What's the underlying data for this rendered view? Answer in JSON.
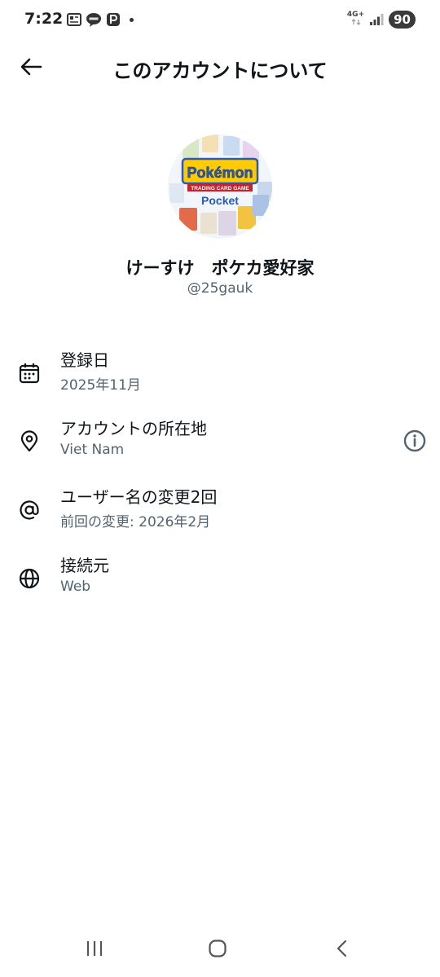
{
  "status_bar": {
    "time": "7:22",
    "network": "4G+",
    "battery": "90"
  },
  "header": {
    "title": "このアカウントについて"
  },
  "profile": {
    "avatar_title": "Pokémon",
    "avatar_banner": "TRADING CARD GAME",
    "avatar_subtitle": "Pocket",
    "display_name": "けーすけ　ポケカ愛好家",
    "handle": "@25gauk"
  },
  "info": [
    {
      "icon": "calendar-icon",
      "title": "登録日",
      "value": "2025年11月"
    },
    {
      "icon": "location-pin-icon",
      "title": "アカウントの所在地",
      "value": "Viet Nam"
    },
    {
      "icon": "at-sign-icon",
      "title": "ユーザー名の変更2回",
      "value": "前回の変更: 2026年2月"
    },
    {
      "icon": "globe-icon",
      "title": "接続元",
      "value": "Web"
    }
  ],
  "colors": {
    "text_primary": "#0f1419",
    "text_secondary": "#536471",
    "pokemon_yellow": "#ffcb05",
    "pokemon_blue": "#2a5ab3"
  }
}
